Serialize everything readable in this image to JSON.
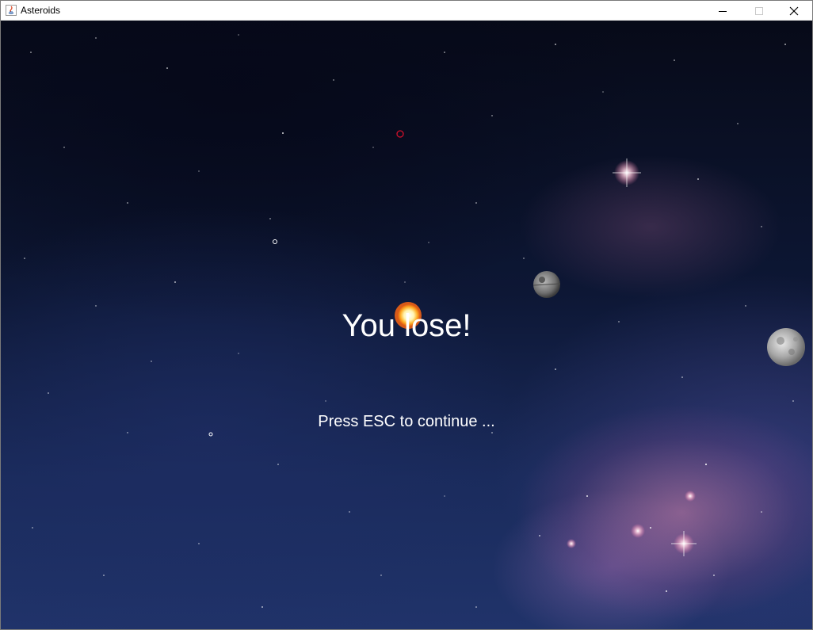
{
  "window": {
    "title": "Asteroids"
  },
  "titlebar_buttons": {
    "minimize_icon": "minimize-icon",
    "maximize_icon": "maximize-icon",
    "close_icon": "close-icon"
  },
  "game": {
    "message": "You lose!",
    "prompt": "Press ESC to continue ..."
  },
  "colors": {
    "text": "#ffffff",
    "target_ring": "#d0102a"
  }
}
